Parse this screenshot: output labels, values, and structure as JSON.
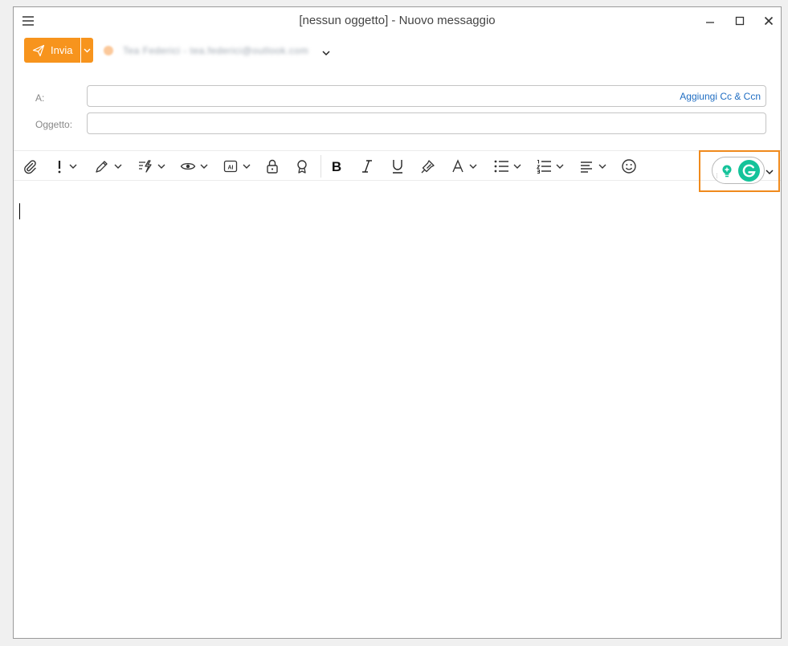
{
  "window": {
    "title": "[nessun oggetto] - Nuovo messaggio"
  },
  "actions": {
    "send_label": "Invia"
  },
  "from": {
    "account": "Tea Federici - tea.federici@outlook.com"
  },
  "fields": {
    "to_label": "A:",
    "to_value": "",
    "cc_link": "Aggiungi Cc & Ccn",
    "subject_label": "Oggetto:",
    "subject_value": ""
  },
  "toolbar": {
    "icons": [
      "attach-icon",
      "priority-icon",
      "signature-icon",
      "templates-icon",
      "read-receipt-icon",
      "ai-icon",
      "encrypt-icon",
      "certificate-icon",
      "bold-icon",
      "italic-icon",
      "underline-icon",
      "format-painter-icon",
      "font-color-icon",
      "bullet-list-icon",
      "numbered-list-icon",
      "align-icon",
      "emoji-icon",
      "grammarly-icon"
    ]
  },
  "colors": {
    "accent": "#f7941d",
    "link": "#1f6dc2",
    "highlight": "#f08a1c",
    "grammarly": "#15c39a"
  },
  "body": {
    "text": ""
  }
}
